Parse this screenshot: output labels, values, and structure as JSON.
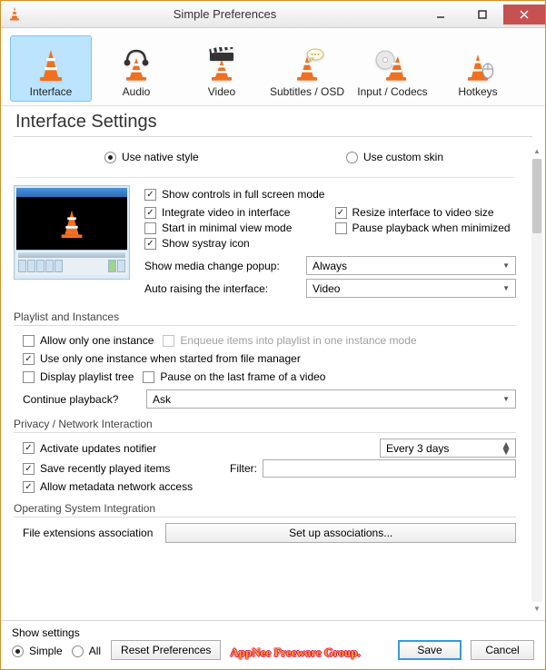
{
  "window": {
    "title": "Simple Preferences"
  },
  "tabs": [
    {
      "label": "Interface"
    },
    {
      "label": "Audio"
    },
    {
      "label": "Video"
    },
    {
      "label": "Subtitles / OSD"
    },
    {
      "label": "Input / Codecs"
    },
    {
      "label": "Hotkeys"
    }
  ],
  "page_title": "Interface Settings",
  "style": {
    "native": "Use native style",
    "custom": "Use custom skin"
  },
  "options": {
    "show_controls": "Show controls in full screen mode",
    "integrate_video": "Integrate video in interface",
    "resize_interface": "Resize interface to video size",
    "start_minimal": "Start in minimal view mode",
    "pause_minimized": "Pause playback when minimized",
    "systray": "Show systray icon",
    "media_popup_label": "Show media change popup:",
    "media_popup_value": "Always",
    "auto_raise_label": "Auto raising the interface:",
    "auto_raise_value": "Video"
  },
  "playlist": {
    "title": "Playlist and Instances",
    "one_instance": "Allow only one instance",
    "enqueue": "Enqueue items into playlist in one instance mode",
    "one_instance_fm": "Use only one instance when started from file manager",
    "display_tree": "Display playlist tree",
    "pause_last_frame": "Pause on the last frame of a video",
    "continue_label": "Continue playback?",
    "continue_value": "Ask"
  },
  "privacy": {
    "title": "Privacy / Network Interaction",
    "updates": "Activate updates notifier",
    "updates_value": "Every 3 days",
    "save_recent": "Save recently played items",
    "filter_label": "Filter:",
    "metadata": "Allow metadata network access"
  },
  "os": {
    "title": "Operating System Integration",
    "assoc_label": "File extensions association",
    "assoc_button": "Set up associations..."
  },
  "footer": {
    "show_settings_label": "Show settings",
    "simple": "Simple",
    "all": "All",
    "reset": "Reset Preferences",
    "freeware": "AppNee Freeware Group.",
    "save": "Save",
    "cancel": "Cancel"
  }
}
